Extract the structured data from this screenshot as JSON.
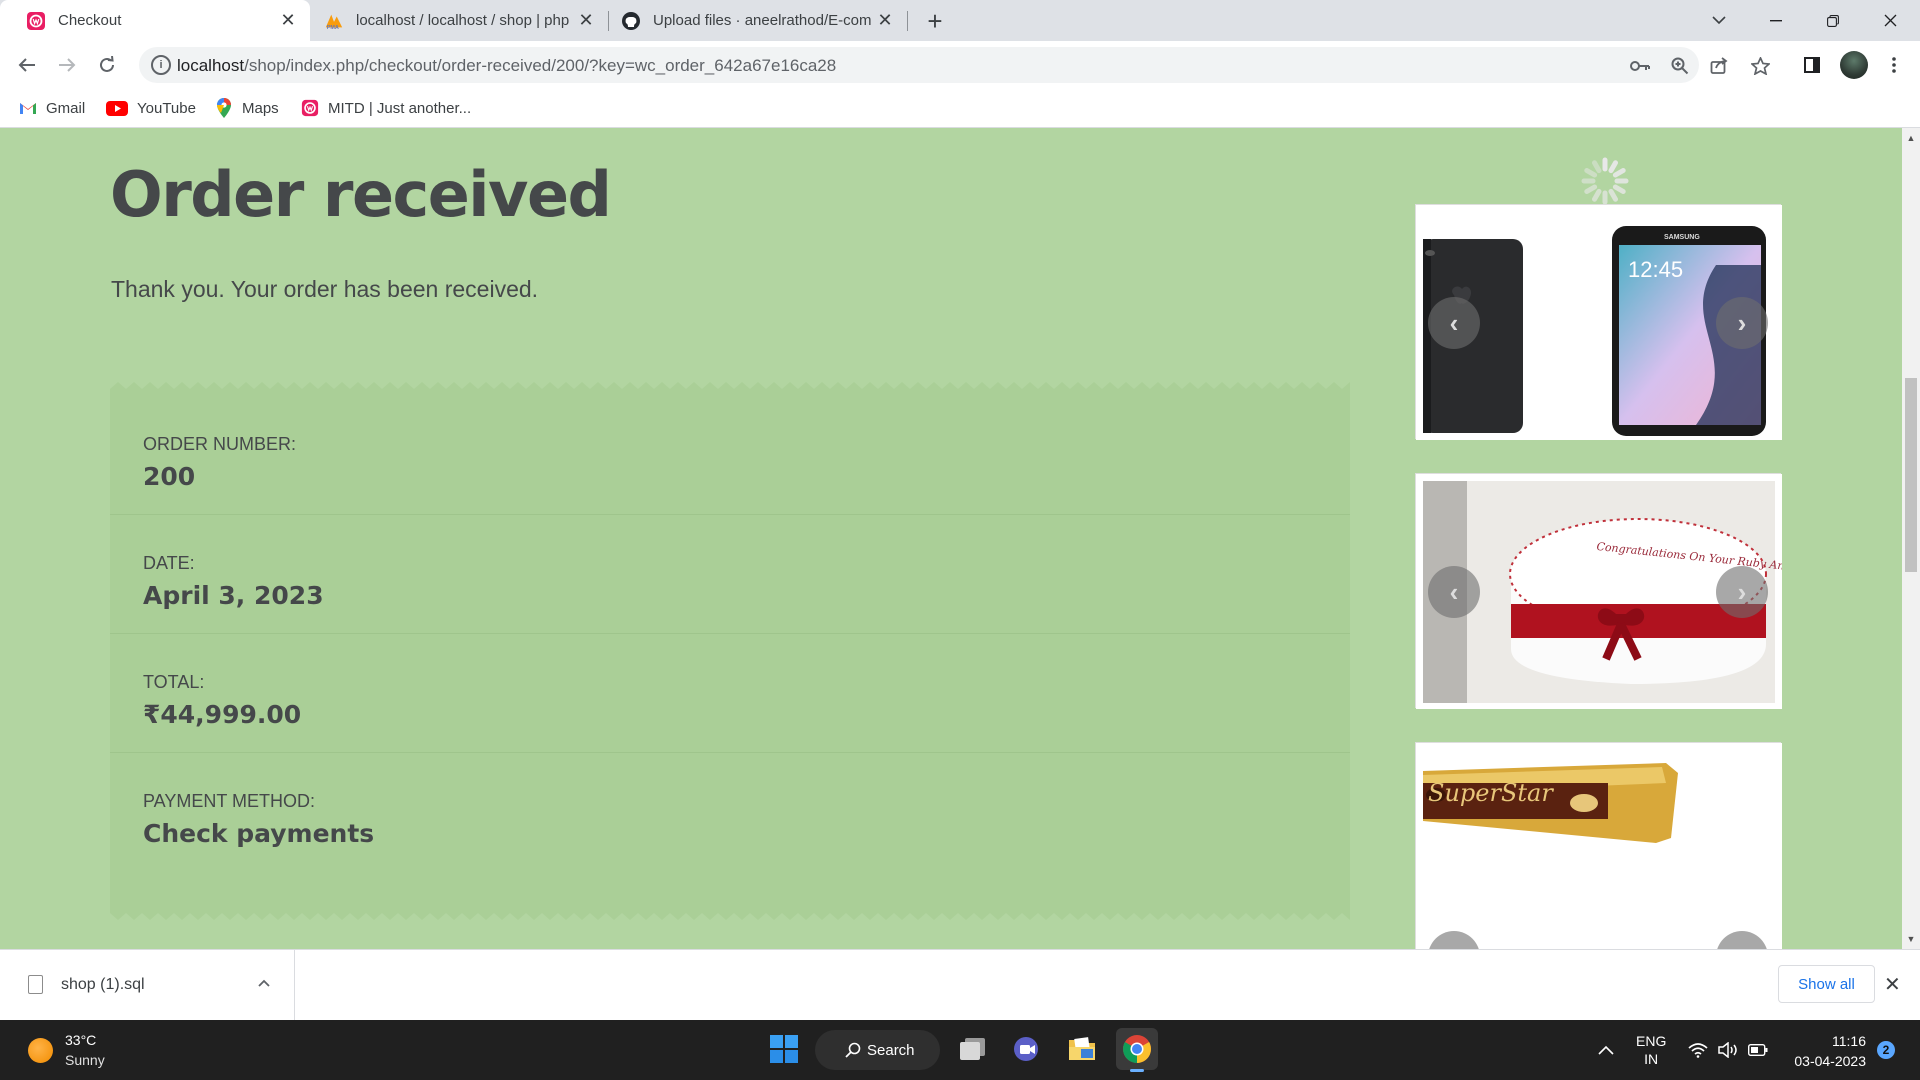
{
  "browser": {
    "tabs": [
      {
        "title": "Checkout",
        "active": true,
        "icon": "wordpress-site-icon"
      },
      {
        "title": "localhost / localhost / shop | php",
        "active": false,
        "icon": "phpmyadmin-icon"
      },
      {
        "title": "Upload files · aneelrathod/E-com",
        "active": false,
        "icon": "github-icon"
      }
    ],
    "url_host": "localhost",
    "url_path": "/shop/index.php/checkout/order-received/200/?key=wc_order_642a67e16ca28",
    "bookmarks": [
      {
        "label": "Gmail",
        "icon": "gmail-icon"
      },
      {
        "label": "YouTube",
        "icon": "youtube-icon"
      },
      {
        "label": "Maps",
        "icon": "maps-icon"
      },
      {
        "label": "MITD | Just another...",
        "icon": "wordpress-site-icon"
      }
    ]
  },
  "page": {
    "title": "Order received",
    "thanks": "Thank you. Your order has been received.",
    "order_details": [
      {
        "label": "ORDER NUMBER:",
        "value": "200"
      },
      {
        "label": "DATE:",
        "value": "April 3, 2023"
      },
      {
        "label": "TOTAL:",
        "value": "₹44,999.00"
      },
      {
        "label": "PAYMENT METHOD:",
        "value": "Check payments"
      }
    ],
    "sidebar_widgets": [
      {
        "subject": "smartphones",
        "phone_clock": "12:45",
        "brand": "SAMSUNG"
      },
      {
        "subject": "anniversary-cake",
        "cake_text": "Congratulations On Your Ruby Anniversary"
      },
      {
        "subject": "chocolate-bar",
        "wrapper_text": "SuperStar"
      }
    ],
    "colors": {
      "background": "#b2d5a1",
      "panel": "#aacf97",
      "text": "#45484a"
    }
  },
  "downloads": {
    "file": "shop (1).sql",
    "show_all": "Show all"
  },
  "taskbar": {
    "temperature": "33°C",
    "condition": "Sunny",
    "search_label": "Search",
    "lang_1": "ENG",
    "lang_2": "IN",
    "time": "11:16",
    "date": "03-04-2023",
    "notifications": "2"
  }
}
